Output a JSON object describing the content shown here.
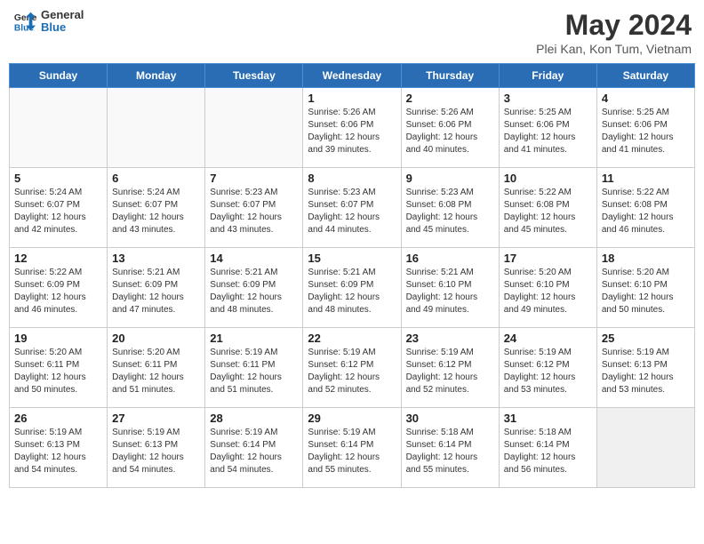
{
  "header": {
    "logo_line1": "General",
    "logo_line2": "Blue",
    "month_year": "May 2024",
    "location": "Plei Kan, Kon Tum, Vietnam"
  },
  "days_of_week": [
    "Sunday",
    "Monday",
    "Tuesday",
    "Wednesday",
    "Thursday",
    "Friday",
    "Saturday"
  ],
  "weeks": [
    [
      {
        "day": "",
        "info": ""
      },
      {
        "day": "",
        "info": ""
      },
      {
        "day": "",
        "info": ""
      },
      {
        "day": "1",
        "info": "Sunrise: 5:26 AM\nSunset: 6:06 PM\nDaylight: 12 hours\nand 39 minutes."
      },
      {
        "day": "2",
        "info": "Sunrise: 5:26 AM\nSunset: 6:06 PM\nDaylight: 12 hours\nand 40 minutes."
      },
      {
        "day": "3",
        "info": "Sunrise: 5:25 AM\nSunset: 6:06 PM\nDaylight: 12 hours\nand 41 minutes."
      },
      {
        "day": "4",
        "info": "Sunrise: 5:25 AM\nSunset: 6:06 PM\nDaylight: 12 hours\nand 41 minutes."
      }
    ],
    [
      {
        "day": "5",
        "info": "Sunrise: 5:24 AM\nSunset: 6:07 PM\nDaylight: 12 hours\nand 42 minutes."
      },
      {
        "day": "6",
        "info": "Sunrise: 5:24 AM\nSunset: 6:07 PM\nDaylight: 12 hours\nand 43 minutes."
      },
      {
        "day": "7",
        "info": "Sunrise: 5:23 AM\nSunset: 6:07 PM\nDaylight: 12 hours\nand 43 minutes."
      },
      {
        "day": "8",
        "info": "Sunrise: 5:23 AM\nSunset: 6:07 PM\nDaylight: 12 hours\nand 44 minutes."
      },
      {
        "day": "9",
        "info": "Sunrise: 5:23 AM\nSunset: 6:08 PM\nDaylight: 12 hours\nand 45 minutes."
      },
      {
        "day": "10",
        "info": "Sunrise: 5:22 AM\nSunset: 6:08 PM\nDaylight: 12 hours\nand 45 minutes."
      },
      {
        "day": "11",
        "info": "Sunrise: 5:22 AM\nSunset: 6:08 PM\nDaylight: 12 hours\nand 46 minutes."
      }
    ],
    [
      {
        "day": "12",
        "info": "Sunrise: 5:22 AM\nSunset: 6:09 PM\nDaylight: 12 hours\nand 46 minutes."
      },
      {
        "day": "13",
        "info": "Sunrise: 5:21 AM\nSunset: 6:09 PM\nDaylight: 12 hours\nand 47 minutes."
      },
      {
        "day": "14",
        "info": "Sunrise: 5:21 AM\nSunset: 6:09 PM\nDaylight: 12 hours\nand 48 minutes."
      },
      {
        "day": "15",
        "info": "Sunrise: 5:21 AM\nSunset: 6:09 PM\nDaylight: 12 hours\nand 48 minutes."
      },
      {
        "day": "16",
        "info": "Sunrise: 5:21 AM\nSunset: 6:10 PM\nDaylight: 12 hours\nand 49 minutes."
      },
      {
        "day": "17",
        "info": "Sunrise: 5:20 AM\nSunset: 6:10 PM\nDaylight: 12 hours\nand 49 minutes."
      },
      {
        "day": "18",
        "info": "Sunrise: 5:20 AM\nSunset: 6:10 PM\nDaylight: 12 hours\nand 50 minutes."
      }
    ],
    [
      {
        "day": "19",
        "info": "Sunrise: 5:20 AM\nSunset: 6:11 PM\nDaylight: 12 hours\nand 50 minutes."
      },
      {
        "day": "20",
        "info": "Sunrise: 5:20 AM\nSunset: 6:11 PM\nDaylight: 12 hours\nand 51 minutes."
      },
      {
        "day": "21",
        "info": "Sunrise: 5:19 AM\nSunset: 6:11 PM\nDaylight: 12 hours\nand 51 minutes."
      },
      {
        "day": "22",
        "info": "Sunrise: 5:19 AM\nSunset: 6:12 PM\nDaylight: 12 hours\nand 52 minutes."
      },
      {
        "day": "23",
        "info": "Sunrise: 5:19 AM\nSunset: 6:12 PM\nDaylight: 12 hours\nand 52 minutes."
      },
      {
        "day": "24",
        "info": "Sunrise: 5:19 AM\nSunset: 6:12 PM\nDaylight: 12 hours\nand 53 minutes."
      },
      {
        "day": "25",
        "info": "Sunrise: 5:19 AM\nSunset: 6:13 PM\nDaylight: 12 hours\nand 53 minutes."
      }
    ],
    [
      {
        "day": "26",
        "info": "Sunrise: 5:19 AM\nSunset: 6:13 PM\nDaylight: 12 hours\nand 54 minutes."
      },
      {
        "day": "27",
        "info": "Sunrise: 5:19 AM\nSunset: 6:13 PM\nDaylight: 12 hours\nand 54 minutes."
      },
      {
        "day": "28",
        "info": "Sunrise: 5:19 AM\nSunset: 6:14 PM\nDaylight: 12 hours\nand 54 minutes."
      },
      {
        "day": "29",
        "info": "Sunrise: 5:19 AM\nSunset: 6:14 PM\nDaylight: 12 hours\nand 55 minutes."
      },
      {
        "day": "30",
        "info": "Sunrise: 5:18 AM\nSunset: 6:14 PM\nDaylight: 12 hours\nand 55 minutes."
      },
      {
        "day": "31",
        "info": "Sunrise: 5:18 AM\nSunset: 6:14 PM\nDaylight: 12 hours\nand 56 minutes."
      },
      {
        "day": "",
        "info": ""
      }
    ]
  ]
}
